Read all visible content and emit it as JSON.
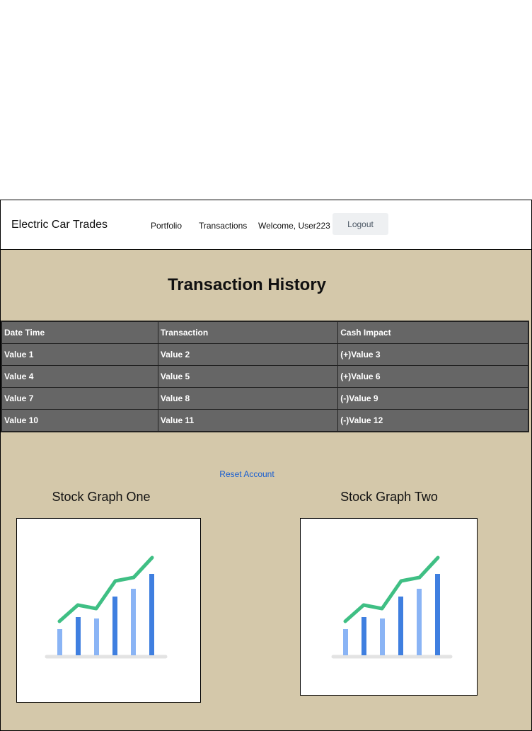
{
  "navbar": {
    "brand": "Electric Car Trades",
    "links": [
      "Portfolio",
      "Transactions"
    ],
    "welcome": "Welcome, User223",
    "logout_label": "Logout"
  },
  "page": {
    "title": "Transaction History"
  },
  "table": {
    "headers": [
      "Date Time",
      "Transaction",
      "Cash Impact"
    ],
    "rows": [
      [
        "Value 1",
        "Value 2",
        "(+)Value 3"
      ],
      [
        "Value 4",
        "Value 5",
        "(+)Value 6"
      ],
      [
        "Value 7",
        "Value 8",
        "(-)Value 9"
      ],
      [
        "Value 10",
        "Value 11",
        "(-)Value 12"
      ]
    ]
  },
  "reset_label": "Reset Account",
  "graphs": [
    {
      "title": "Stock Graph One",
      "icon": "bar-line-chart-icon"
    },
    {
      "title": "Stock Graph Two",
      "icon": "bar-line-chart-icon"
    }
  ],
  "colors": {
    "background": "#d4c8aa",
    "table_bg": "#666666",
    "link": "#1a5fd0",
    "chart_green": "#3fbf84",
    "chart_blue_dark": "#3f7fe0",
    "chart_blue_light": "#8ab4f5"
  }
}
